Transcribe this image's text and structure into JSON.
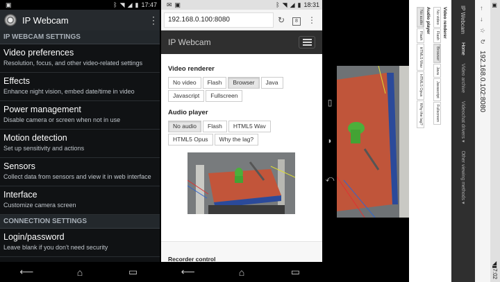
{
  "panel1": {
    "status": {
      "time": "17:47"
    },
    "app_title": "IP Webcam",
    "sections": [
      {
        "header": "IP WEBCAM SETTINGS",
        "items": [
          {
            "title": "Video preferences",
            "subtitle": "Resolution, focus, and other video-related settings"
          },
          {
            "title": "Effects",
            "subtitle": "Enhance night vision, embed date/time in video"
          },
          {
            "title": "Power management",
            "subtitle": "Disable camera or screen when not in use"
          },
          {
            "title": "Motion detection",
            "subtitle": "Set up sensitivity and actions"
          },
          {
            "title": "Sensors",
            "subtitle": "Collect data from sensors and view it in web interface"
          },
          {
            "title": "Interface",
            "subtitle": "Customize camera screen"
          }
        ]
      },
      {
        "header": "CONNECTION SETTINGS",
        "items": [
          {
            "title": "Login/password",
            "subtitle": "Leave blank if you don't need security"
          }
        ]
      }
    ]
  },
  "panel2": {
    "status": {
      "time": "18:31"
    },
    "url": "192.168.0.100:8080",
    "tabs_count": "8",
    "site_title": "IP Webcam",
    "video_renderer": {
      "label": "Video renderer",
      "options": [
        "No video",
        "Flash",
        "Browser",
        "Java",
        "Javascript",
        "Fullscreen"
      ],
      "selected": "Browser"
    },
    "audio_player": {
      "label": "Audio player",
      "options": [
        "No audio",
        "Flash",
        "HTML5 Wav",
        "HTML5 Opus",
        "Why the lag?"
      ],
      "selected": "No audio"
    },
    "recorder_label": "Recorder control"
  },
  "panel3": {
    "video_renderer": {
      "label": "Video renderer",
      "options": [
        "No video",
        "Flash",
        "Browser",
        "Java",
        "Javascript",
        "Fullscreen"
      ],
      "selected": "Browser"
    },
    "audio_player": {
      "label": "Audio player",
      "options": [
        "No audio",
        "Flash",
        "HTML5 Wav",
        "HTML5 Opus",
        "Why the lag?"
      ],
      "selected": "No audio"
    }
  },
  "panel4": {
    "status": {
      "time": "7:02"
    },
    "url": "192.168.0.102:8080",
    "site_title": "IP Webcam",
    "nav_tabs": [
      "Home",
      "Video archive",
      "Videochat drivers ▾",
      "Other viewing methods ▾"
    ]
  },
  "icons": {
    "signal": "signal-icon",
    "wifi": "wifi-icon",
    "battery": "battery-icon",
    "back": "back-icon",
    "home": "home-icon",
    "recents": "recents-icon"
  }
}
